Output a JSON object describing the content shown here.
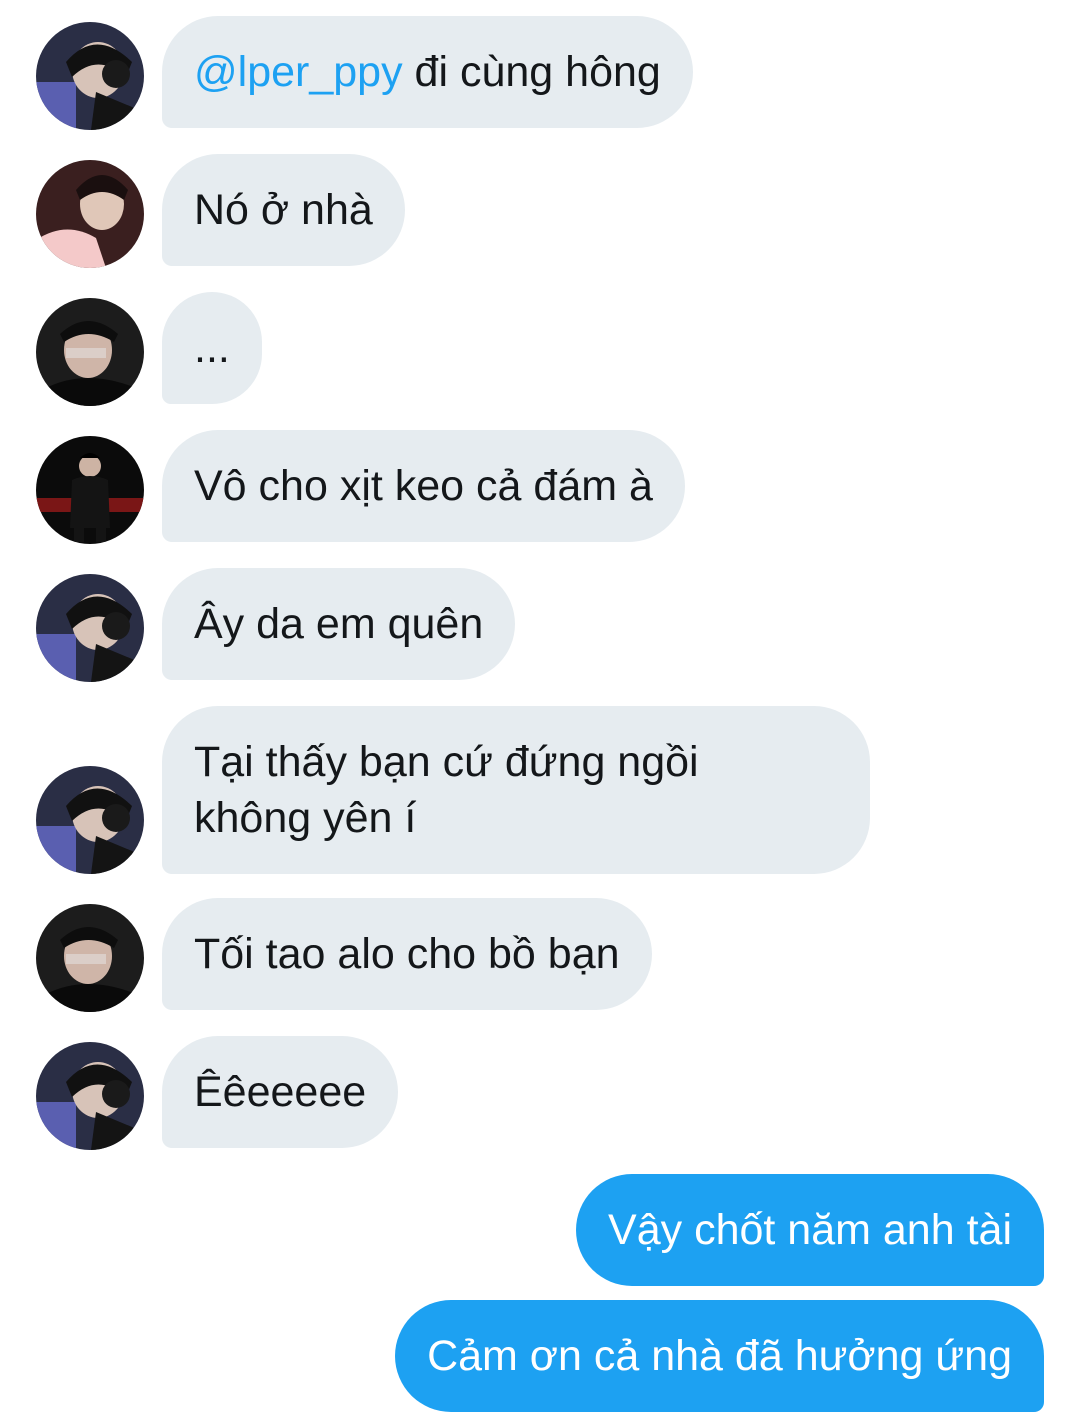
{
  "messages": [
    {
      "sender": "avatar-a",
      "mention": "@lper_ppy",
      "text": " đi cùng hông"
    },
    {
      "sender": "avatar-b",
      "text": "Nó ở nhà"
    },
    {
      "sender": "avatar-c",
      "text": "..."
    },
    {
      "sender": "avatar-d",
      "text": "Vô cho xịt keo cả đám à"
    },
    {
      "sender": "avatar-a",
      "text": "Ây da em quên"
    },
    {
      "sender": "avatar-a",
      "line1": "Tại thấy bạn cứ đứng ngồi",
      "line2": "không yên í"
    },
    {
      "sender": "avatar-c",
      "text": "Tối tao alo cho bồ bạn"
    },
    {
      "sender": "avatar-a",
      "text": "Êêeeeee"
    },
    {
      "sender": "me",
      "text": "Vậy chốt năm anh tài"
    },
    {
      "sender": "me",
      "text": "Cảm ơn cả nhà đã hưởng ứng"
    }
  ],
  "colors": {
    "incoming_bubble": "#e6ecf0",
    "outgoing_bubble": "#1da1f2",
    "mention": "#1da1f2",
    "text": "#14171a"
  }
}
